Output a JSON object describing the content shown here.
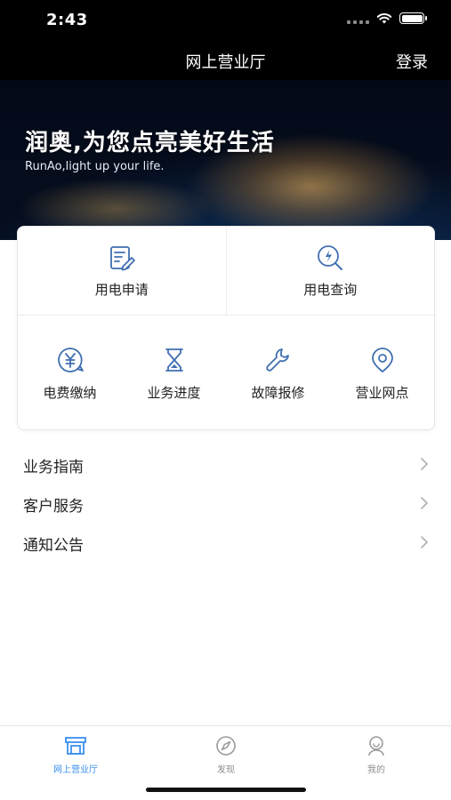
{
  "status_bar": {
    "time": "2:43"
  },
  "nav": {
    "title": "网上营业厅",
    "login": "登录"
  },
  "banner": {
    "title": "润奥,为您点亮美好生活",
    "subtitle": "RunAo,light up your life."
  },
  "services_top": [
    {
      "label": "用电申请",
      "icon": "edit-document-icon"
    },
    {
      "label": "用电查询",
      "icon": "power-search-icon"
    }
  ],
  "services_bottom": [
    {
      "label": "电费缴纳",
      "icon": "yuan-bubble-icon"
    },
    {
      "label": "业务进度",
      "icon": "hourglass-icon"
    },
    {
      "label": "故障报修",
      "icon": "wrench-icon"
    },
    {
      "label": "营业网点",
      "icon": "location-pin-icon"
    }
  ],
  "list": [
    {
      "label": "业务指南"
    },
    {
      "label": "客户服务"
    },
    {
      "label": "通知公告"
    }
  ],
  "tabbar": [
    {
      "label": "网上营业厅",
      "icon": "storefront-icon",
      "active": true
    },
    {
      "label": "发现",
      "icon": "compass-icon",
      "active": false
    },
    {
      "label": "我的",
      "icon": "user-icon",
      "active": false
    }
  ],
  "colors": {
    "icon": "#3f6fb0",
    "active_tab": "#3b8ff0",
    "inactive_tab": "#8c8c8c",
    "topbar": "#000000"
  }
}
